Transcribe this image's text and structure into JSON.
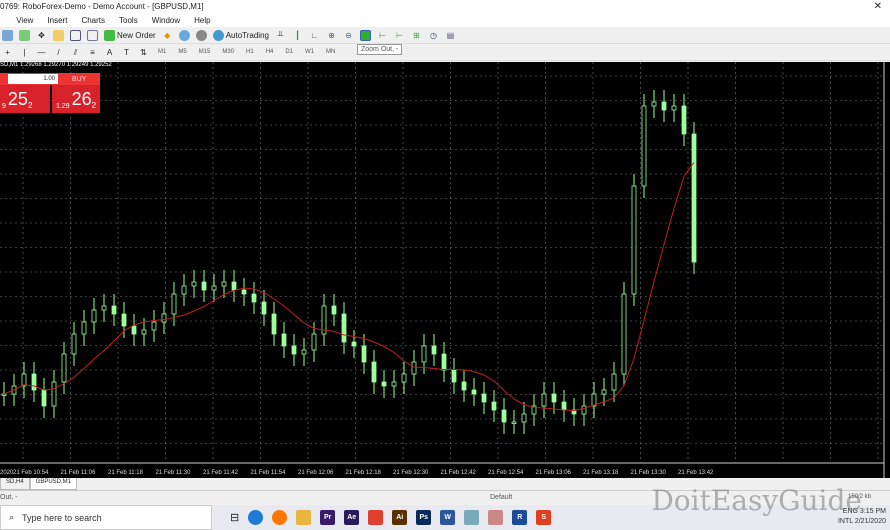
{
  "window": {
    "title": "0769: RoboForex-Demo - Demo Account - [GBPUSD,M1]",
    "close": "✕"
  },
  "menu": [
    "View",
    "Insert",
    "Charts",
    "Tools",
    "Window",
    "Help"
  ],
  "toolbar": {
    "new_order": "New Order",
    "autotrading": "AutoTrading",
    "timeframes": [
      "M1",
      "M5",
      "M15",
      "M30",
      "H1",
      "H4",
      "D1",
      "W1",
      "MN"
    ],
    "tooltip": "Zoom Out, -"
  },
  "chart": {
    "symbol_line": "SD,M1  1.29268 1.29270 1.29249 1.29252",
    "one_click": {
      "lot": "1.00",
      "buy": "BUY",
      "sell_prefix": "9",
      "sell_big": "25",
      "sell_sup": "2",
      "buy_prefix": "1.29",
      "buy_big": "26",
      "buy_sup": "2"
    },
    "time_labels": [
      "2020",
      "21 Feb 10:54",
      "21 Feb 11:06",
      "21 Feb 11:18",
      "21 Feb 11:30",
      "21 Feb 11:42",
      "21 Feb 11:54",
      "21 Feb 12:06",
      "21 Feb 12:18",
      "21 Feb 12:30",
      "21 Feb 12:42",
      "21 Feb 12:54",
      "21 Feb 13:06",
      "21 Feb 13:18",
      "21 Feb 13:30",
      "21 Feb 13:42"
    ],
    "ylim": [
      1.292,
      1.293
    ],
    "candle_color": "#9cff9c",
    "ma_color": "#c02020",
    "closes": [
      1.29219,
      1.29221,
      1.29224,
      1.2922,
      1.29216,
      1.29222,
      1.29229,
      1.29234,
      1.29237,
      1.2924,
      1.29241,
      1.29239,
      1.29236,
      1.29234,
      1.29235,
      1.29237,
      1.29239,
      1.29244,
      1.29246,
      1.29247,
      1.29245,
      1.29246,
      1.29247,
      1.29245,
      1.29244,
      1.29242,
      1.29239,
      1.29234,
      1.29231,
      1.29229,
      1.2923,
      1.29234,
      1.29241,
      1.29239,
      1.29232,
      1.29231,
      1.29227,
      1.29222,
      1.29221,
      1.29222,
      1.29224,
      1.29227,
      1.29231,
      1.29229,
      1.29225,
      1.29222,
      1.2922,
      1.29219,
      1.29217,
      1.29215,
      1.29212,
      1.29212,
      1.29214,
      1.29216,
      1.29219,
      1.29217,
      1.29215,
      1.29214,
      1.29216,
      1.29219,
      1.2922,
      1.29224,
      1.29244,
      1.29271,
      1.29291,
      1.29292,
      1.2929,
      1.29291,
      1.29284,
      1.29252
    ]
  },
  "tabs": [
    "SD,H4",
    "GBPUSD,M1"
  ],
  "status": {
    "left": "Out, -",
    "profile": "Default",
    "traffic": "150/2 kb"
  },
  "taskbar": {
    "search": "Type here to search",
    "apps": [
      {
        "n": "Pr",
        "c": "#3a1a6a"
      },
      {
        "n": "Ae",
        "c": "#2a1a5a"
      },
      {
        "n": "",
        "c": "#e04030"
      },
      {
        "n": "Ai",
        "c": "#5a3000"
      },
      {
        "n": "Ps",
        "c": "#0a2a5a"
      },
      {
        "n": "W",
        "c": "#2b579a"
      },
      {
        "n": "",
        "c": "#7ab"
      },
      {
        "n": "",
        "c": "#c88"
      },
      {
        "n": "R",
        "c": "#1a4a9a"
      },
      {
        "n": "S",
        "c": "#e04020"
      }
    ],
    "lang": "ENG",
    "lang2": "INTL",
    "time": "3:15 PM",
    "date": "2/21/2020"
  },
  "watermark": "DoitEasyGuide"
}
